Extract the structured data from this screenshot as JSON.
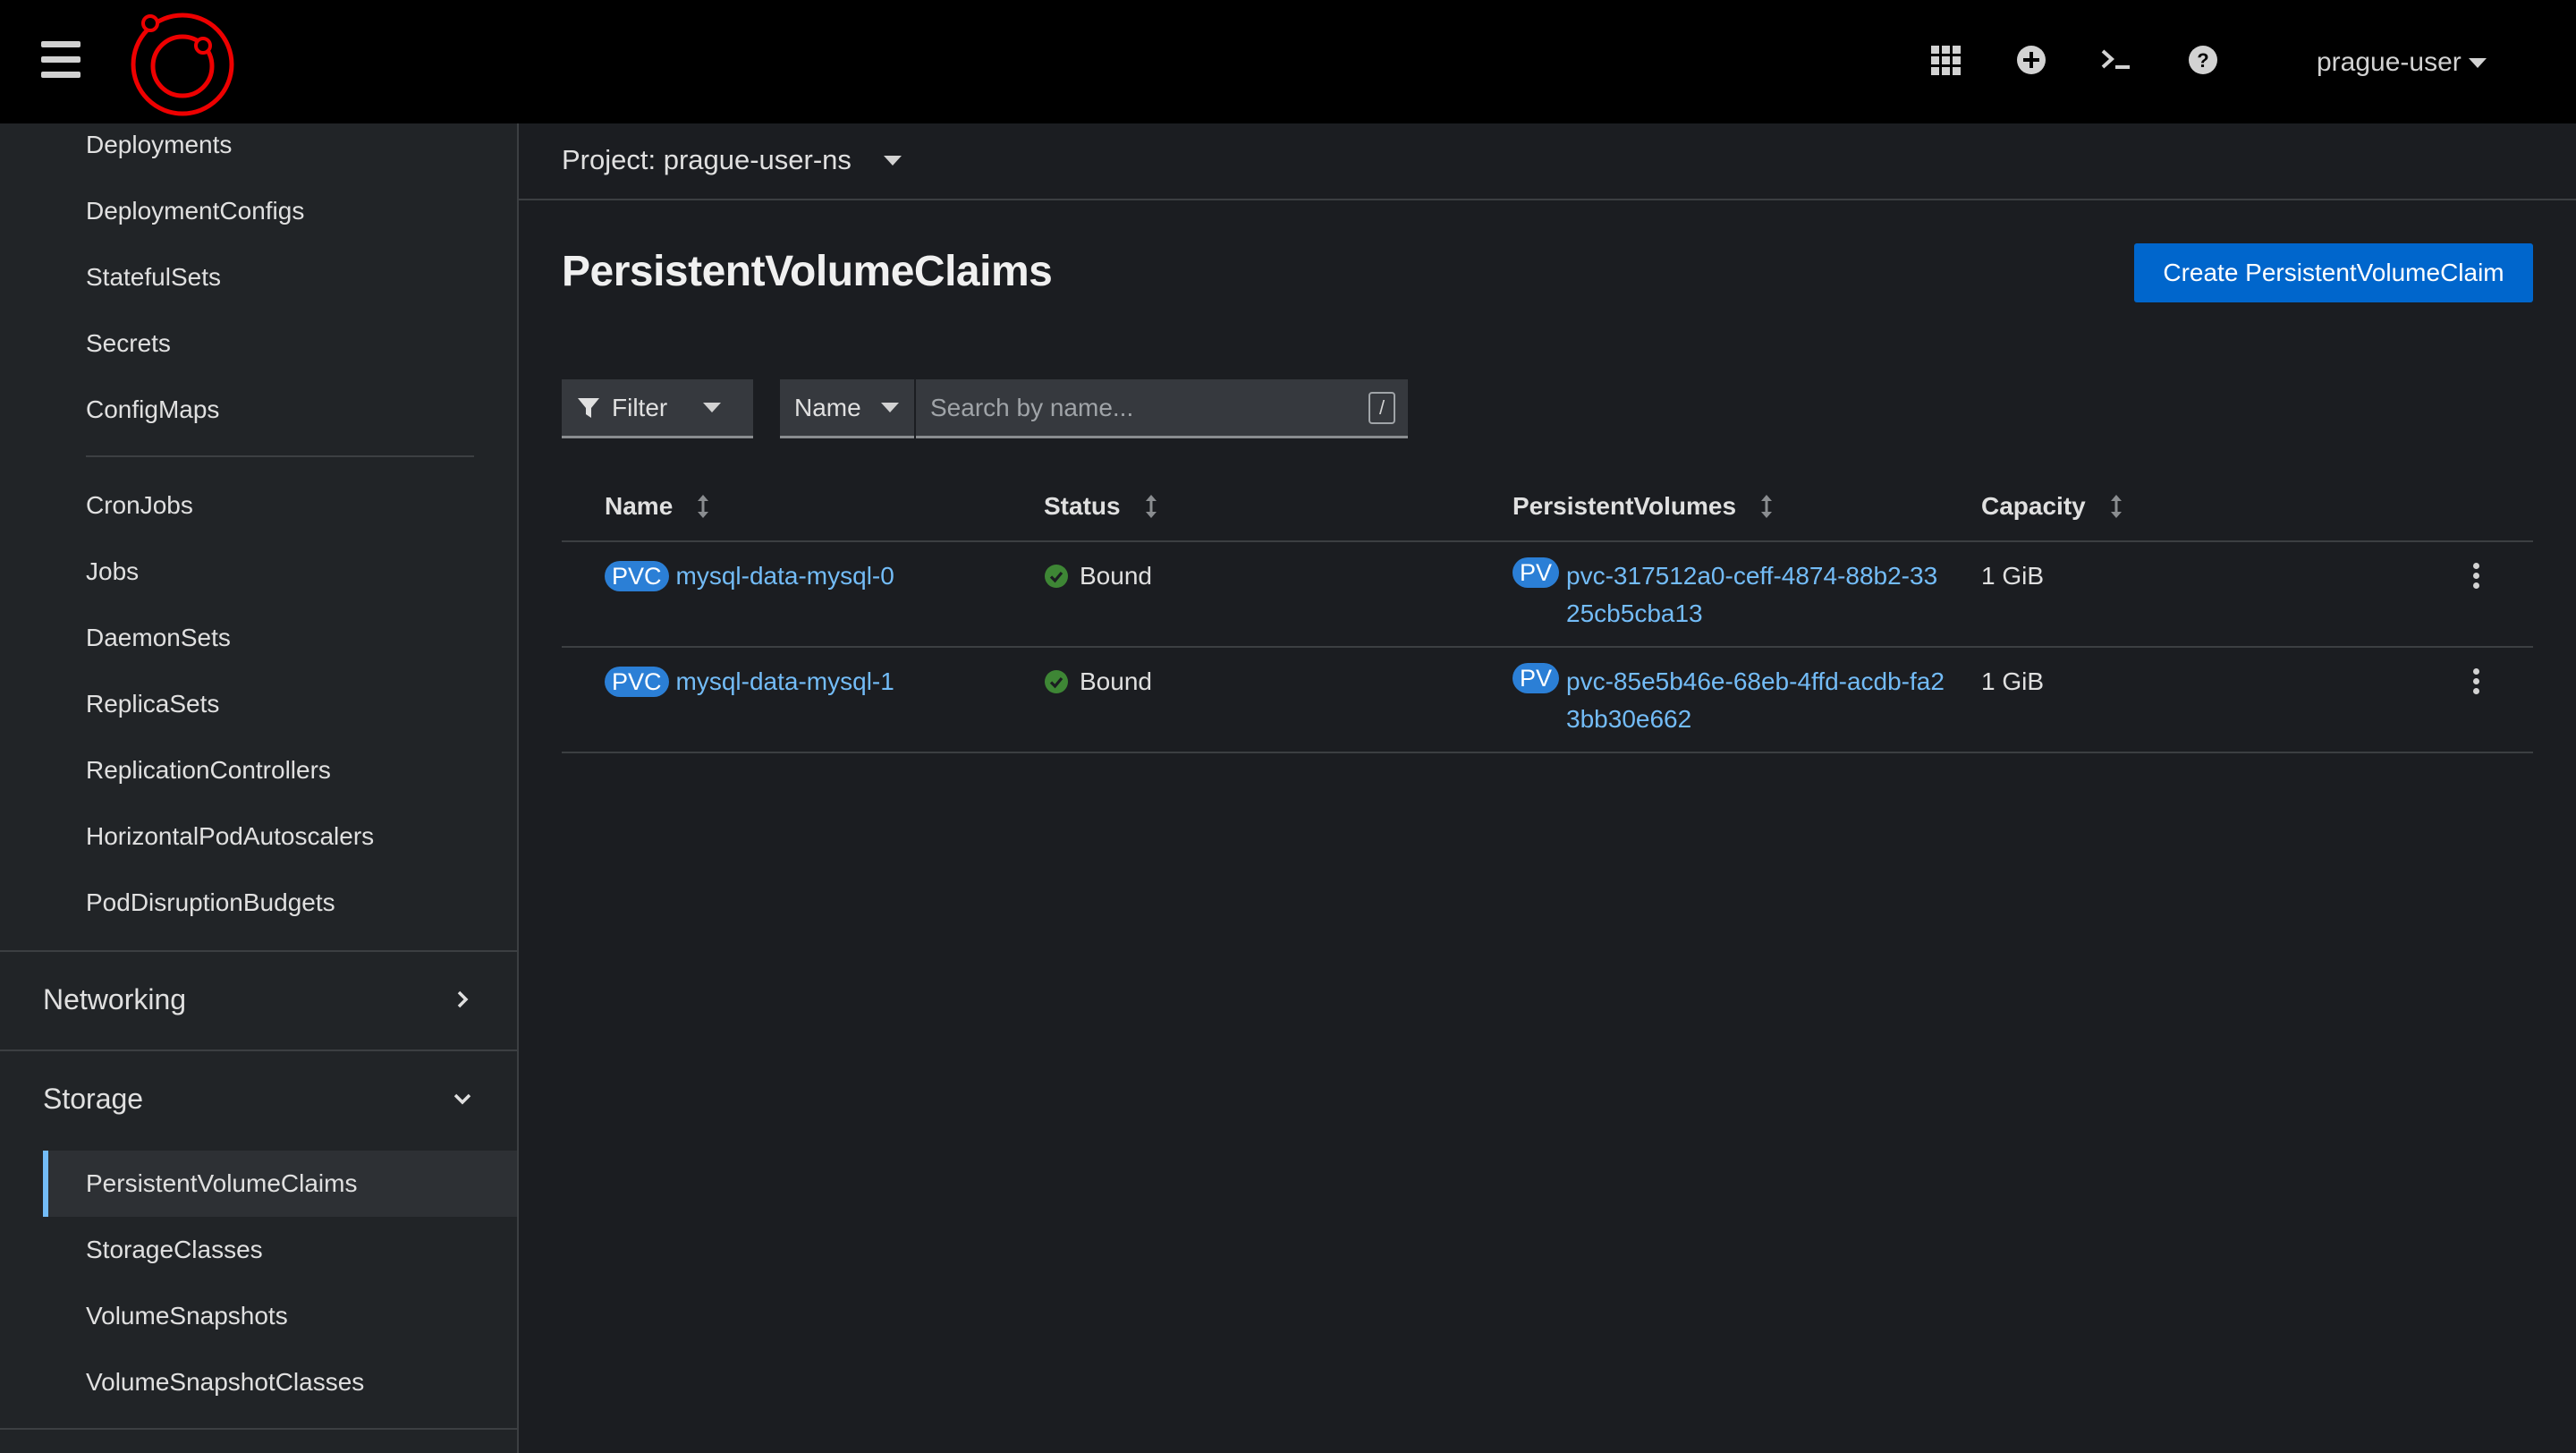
{
  "masthead": {
    "user_label": "prague-user",
    "icons": [
      "grid-icon",
      "plus-circle-icon",
      "terminal-icon",
      "help-icon"
    ]
  },
  "sidebar": {
    "workload_items": [
      "Deployments",
      "DeploymentConfigs",
      "StatefulSets",
      "Secrets",
      "ConfigMaps"
    ],
    "job_items": [
      "CronJobs",
      "Jobs",
      "DaemonSets",
      "ReplicaSets",
      "ReplicationControllers",
      "HorizontalPodAutoscalers",
      "PodDisruptionBudgets"
    ],
    "networking_label": "Networking",
    "storage_label": "Storage",
    "storage_items": [
      "PersistentVolumeClaims",
      "StorageClasses",
      "VolumeSnapshots",
      "VolumeSnapshotClasses"
    ],
    "active_item": "PersistentVolumeClaims"
  },
  "project": {
    "label": "Project: prague-user-ns"
  },
  "page": {
    "title": "PersistentVolumeClaims",
    "create_button": "Create PersistentVolumeClaim"
  },
  "toolbar": {
    "filter_label": "Filter",
    "name_select": "Name",
    "search_placeholder": "Search by name...",
    "shortcut_key": "/"
  },
  "table": {
    "columns": [
      "Name",
      "Status",
      "PersistentVolumes",
      "Capacity"
    ],
    "rows": [
      {
        "name_badge": "PVC",
        "name": "mysql-data-mysql-0",
        "status": "Bound",
        "pv_badge": "PV",
        "pv": "pvc-317512a0-ceff-4874-88b2-3325cb5cba13",
        "capacity": "1 GiB"
      },
      {
        "name_badge": "PVC",
        "name": "mysql-data-mysql-1",
        "status": "Bound",
        "pv_badge": "PV",
        "pv": "pvc-85e5b46e-68eb-4ffd-acdb-fa23bb30e662",
        "capacity": "1 GiB"
      }
    ]
  },
  "colors": {
    "accent": "#0066cc",
    "link": "#73bcf7",
    "success": "#3e8635",
    "logo": "#ee0000"
  }
}
